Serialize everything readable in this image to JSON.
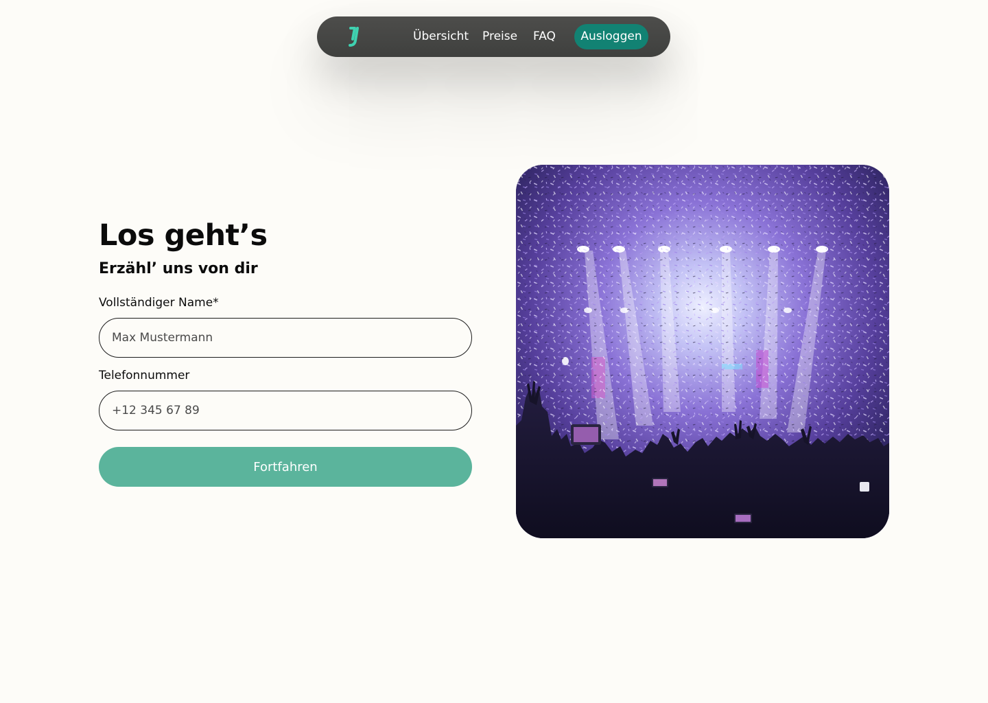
{
  "nav": {
    "logo_icon": "brand-logo-icon",
    "links": [
      {
        "label": "Übersicht"
      },
      {
        "label": "Preise"
      },
      {
        "label": "FAQ"
      }
    ],
    "logout_label": "Ausloggen",
    "colors": {
      "bar": "#474745",
      "logout": "#128273",
      "logo": "#3fd1b0"
    }
  },
  "form": {
    "title": "Los geht’s",
    "subtitle": "Erzähl’ uns von dir",
    "name_label": "Vollständiger Name*",
    "name_placeholder": "Max Mustermann",
    "name_value": "",
    "phone_label": "Telefonnummer",
    "phone_placeholder": "+12 345 67 89",
    "phone_value": "",
    "submit_label": "Fortfahren",
    "colors": {
      "submit": "#5bb49c"
    }
  },
  "hero": {
    "image": "concert-crowd-confetti-image",
    "colors": {
      "glow": "#b9a9ff",
      "confetti": "#cbb8ff",
      "crowd": "#141226"
    }
  }
}
